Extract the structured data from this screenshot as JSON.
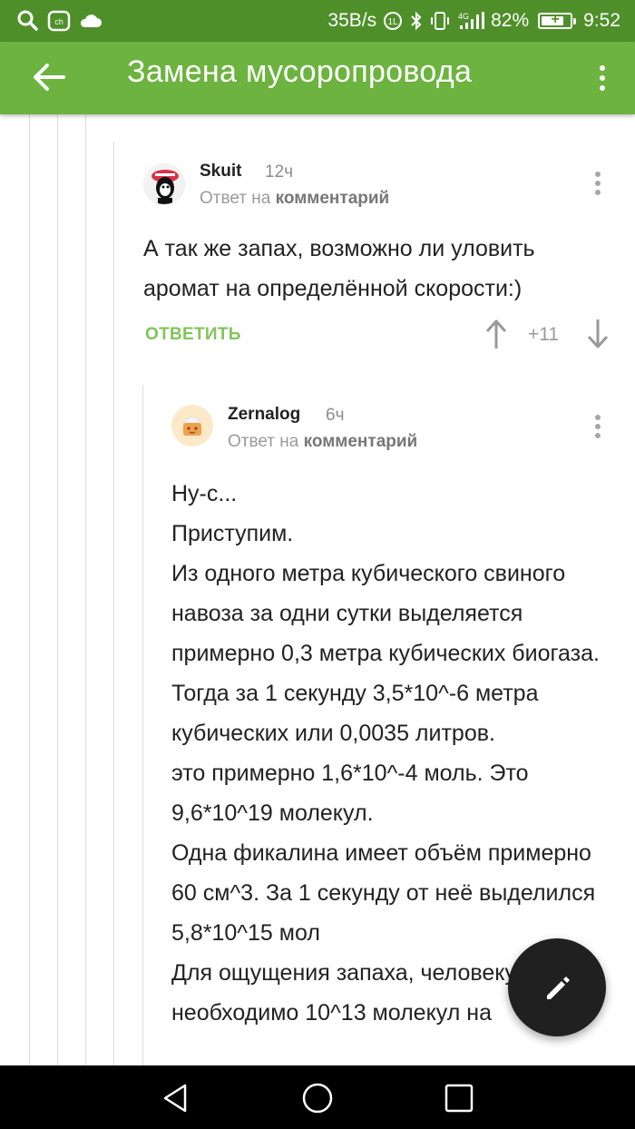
{
  "status_bar": {
    "speed": "35B/s",
    "battery": "82%",
    "battery_level": 0.82,
    "time": "9:52",
    "left_icons": [
      "search-icon",
      "app-icon",
      "cloud-icon"
    ],
    "right_icons": [
      "data-saver-icon",
      "bluetooth-icon",
      "vibrate-icon",
      "signal-4g-icon",
      "battery-charging-icon"
    ]
  },
  "app_bar": {
    "title": "Замена мусоропровода",
    "back_icon": "arrow-back-icon",
    "menu_icon": "more-vertical-icon"
  },
  "comments": [
    {
      "author": "Skuit",
      "time": "12ч",
      "reply_prefix": "Ответ на",
      "reply_link": "комментарий",
      "text": [
        "А так же запах, возможно ли уловить аромат на определённой скорости:)"
      ],
      "reply_label": "ОТВЕТИТЬ",
      "score": "+11"
    },
    {
      "author": "Zernalog",
      "time": "6ч",
      "reply_prefix": "Ответ на",
      "reply_link": "комментарий",
      "text": [
        "Ну-с...",
        "Приступим.",
        "Из одного метра кубического свиного навоза за одни сутки выделяется примерно 0,3 метра кубических биогаза.",
        "Тогда за 1 секунду 3,5*10^-6 метра кубических или 0,0035 литров.",
        "это примерно 1,6*10^-4 моль. Это 9,6*10^19 молекул.",
        "Одна фикалина имеет объём примерно 60 см^3. За 1 секунду от неё выделился 5,8*10^15 мол",
        "Для ощущения запаха, человеку необходимо 10^13 молекул на"
      ]
    }
  ],
  "fab": {
    "icon": "pencil-icon"
  },
  "nav_bar": {
    "icons": [
      "back-triangle-icon",
      "home-circle-icon",
      "recents-square-icon"
    ]
  },
  "colors": {
    "status_bar": "#4f8f2a",
    "app_bar": "#6cb33f",
    "reply_green": "#82c45a",
    "fab": "#202020"
  }
}
